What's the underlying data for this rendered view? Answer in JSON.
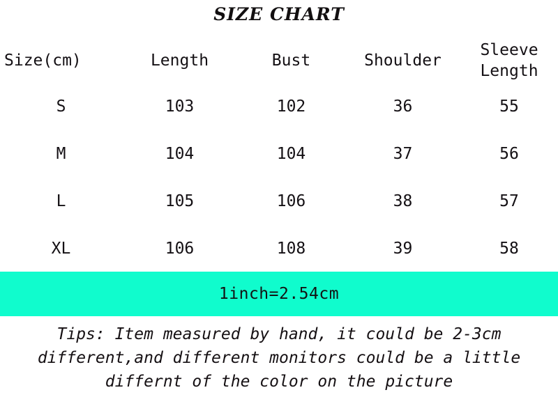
{
  "title": "SIZE CHART",
  "table": {
    "headers": [
      {
        "label": "Size(cm)",
        "lines": [
          "Size(cm)"
        ]
      },
      {
        "label": "Length",
        "lines": [
          "Length"
        ]
      },
      {
        "label": "Bust",
        "lines": [
          "Bust"
        ]
      },
      {
        "label": "Shoulder",
        "lines": [
          "Shoulder"
        ]
      },
      {
        "label": "Sleeve Length",
        "lines": [
          "Sleeve",
          "Length"
        ]
      }
    ],
    "rows": [
      {
        "size": "S",
        "length": "103",
        "bust": "102",
        "shoulder": "36",
        "sleeve_length": "55"
      },
      {
        "size": "M",
        "length": "104",
        "bust": "104",
        "shoulder": "37",
        "sleeve_length": "56"
      },
      {
        "size": "L",
        "length": "105",
        "bust": "106",
        "shoulder": "38",
        "sleeve_length": "57"
      },
      {
        "size": "XL",
        "length": "106",
        "bust": "108",
        "shoulder": "39",
        "sleeve_length": "58"
      }
    ]
  },
  "conversion": {
    "text": "1inch=2.54cm",
    "background_color": "#10fccd",
    "text_color": "#131313"
  },
  "tips": {
    "lines": [
      "Tips: Item measured by hand, it could be 2-3cm",
      "different,and different monitors could be a little",
      "differnt of the color on the picture"
    ]
  },
  "colors": {
    "page_background": "#ffffff",
    "text": "#141014",
    "accent": "#10fccd"
  },
  "chart_data": {
    "type": "table",
    "title": "SIZE CHART",
    "columns": [
      "Size(cm)",
      "Length",
      "Bust",
      "Shoulder",
      "Sleeve Length"
    ],
    "rows": [
      [
        "S",
        103,
        102,
        36,
        55
      ],
      [
        "M",
        104,
        104,
        37,
        56
      ],
      [
        "L",
        105,
        106,
        38,
        57
      ],
      [
        "XL",
        106,
        108,
        39,
        58
      ]
    ],
    "units": "cm",
    "note": "1inch=2.54cm"
  }
}
